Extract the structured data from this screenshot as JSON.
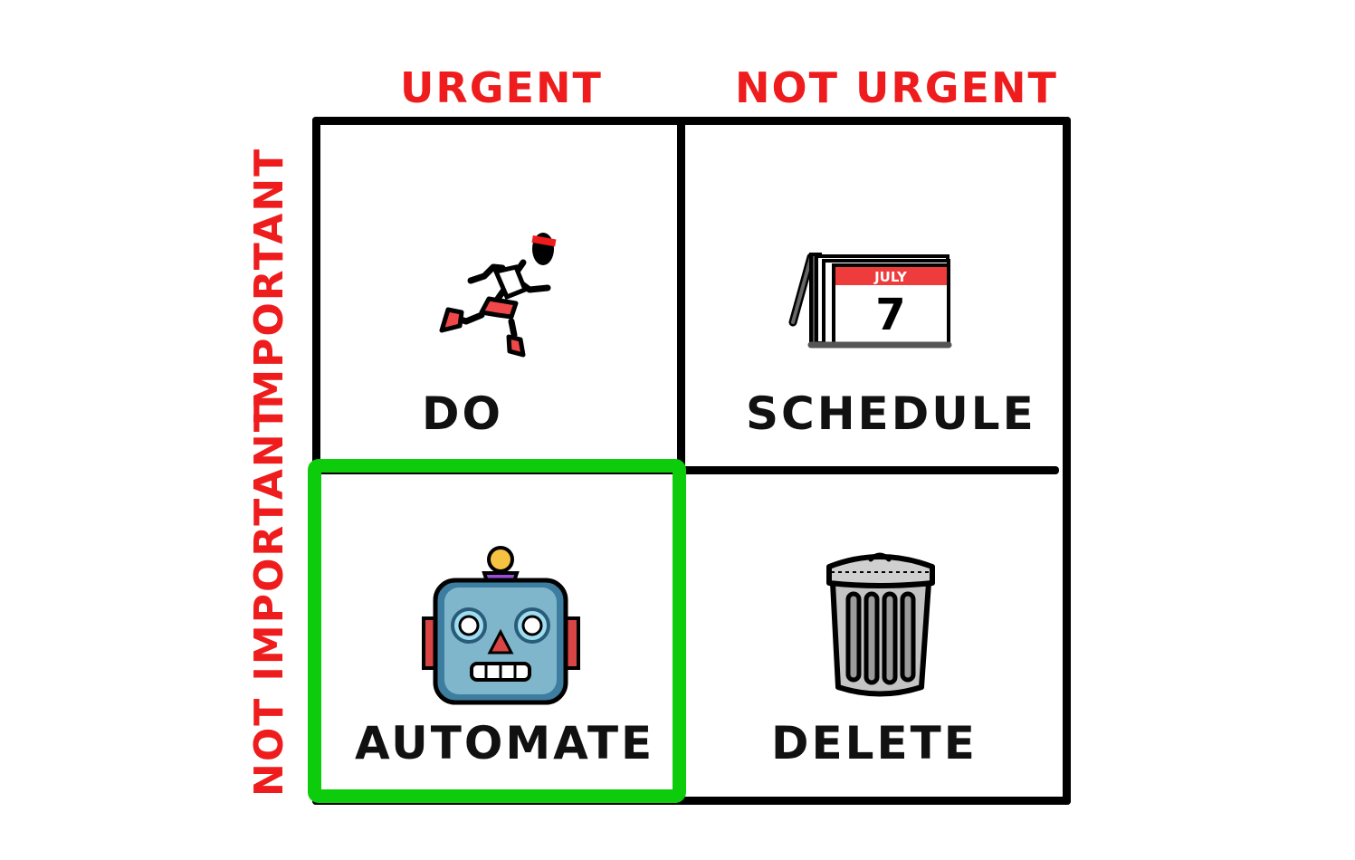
{
  "matrix": {
    "columns": [
      "URGENT",
      "NOT URGENT"
    ],
    "rows": [
      "IMPORTANT",
      "NOT IMPORTANT"
    ],
    "quadrants": [
      {
        "label": "DO",
        "icon": "running-person-icon"
      },
      {
        "label": "SCHEDULE",
        "icon": "calendar-icon",
        "calendar_month": "JULY",
        "calendar_day": "7"
      },
      {
        "label": "AUTOMATE",
        "icon": "robot-icon",
        "highlighted": true
      },
      {
        "label": "DELETE",
        "icon": "trash-can-icon"
      }
    ],
    "colors": {
      "axis_label": "#ee1c1c",
      "highlight": "#0ccc0c",
      "grid": "#000000"
    }
  }
}
